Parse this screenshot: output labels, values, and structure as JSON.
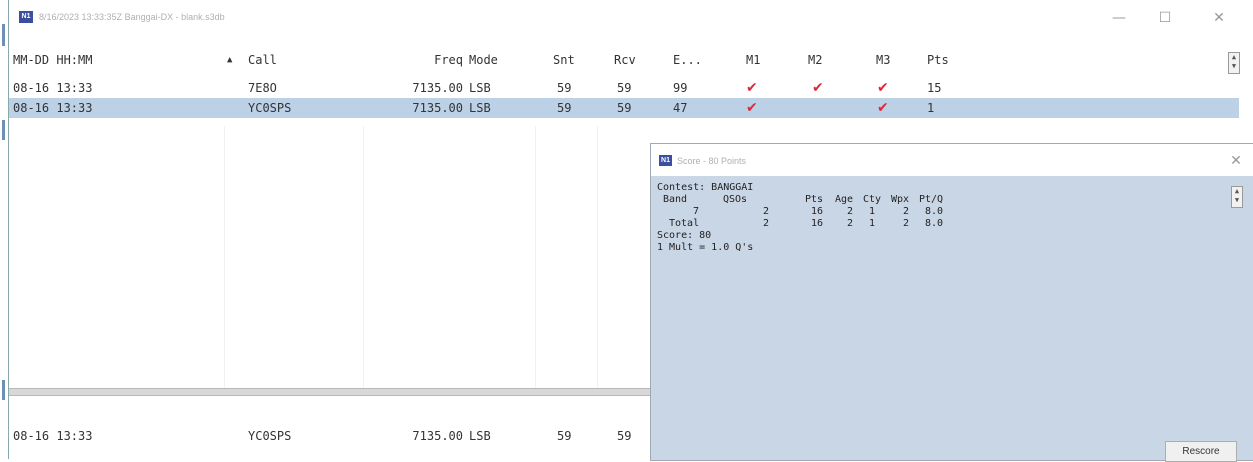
{
  "window": {
    "title": "8/16/2023 13:33:35Z Banggai-DX - blank.s3db",
    "minimize_glyph": "—",
    "maximize_glyph": "☐",
    "close_glyph": "✕",
    "icon": "n1mm-logo-icon"
  },
  "log": {
    "columns": {
      "datetime": "MM-DD HH:MM",
      "sort_indicator": "▲",
      "call": "Call",
      "freq": "Freq",
      "mode": "Mode",
      "snt": "Snt",
      "rcv": "Rcv",
      "exch": "E...",
      "m1": "M1",
      "m2": "M2",
      "m3": "M3",
      "pts": "Pts"
    },
    "rows": [
      {
        "datetime": "08-16 13:33",
        "call": "7E8O",
        "freq": "7135.00",
        "mode": "LSB",
        "snt": "59",
        "rcv": "59",
        "exch": "99",
        "m1": "✔",
        "m2": "✔",
        "m3": "✔",
        "pts": "15"
      },
      {
        "datetime": "08-16 13:33",
        "call": "YC0SPS",
        "freq": "7135.00",
        "mode": "LSB",
        "snt": "59",
        "rcv": "59",
        "exch": "47",
        "m1": "✔",
        "m2": "",
        "m3": "✔",
        "pts": "1"
      }
    ],
    "entry": {
      "datetime": "08-16 13:33",
      "call": "YC0SPS",
      "freq": "7135.00",
      "mode": "LSB",
      "snt": "59",
      "rcv": "59"
    }
  },
  "score_window": {
    "title": "Score - 80 Points",
    "close_glyph": "✕",
    "contest_line": "Contest: BANGGAI",
    "headers": {
      "band": "Band",
      "qsos": "QSOs",
      "pts": "Pts",
      "age": "Age",
      "cty": "Cty",
      "wpx": "Wpx",
      "ptq": "Pt/Q"
    },
    "rows": [
      {
        "band": "7",
        "qsos": "2",
        "pts": "16",
        "age": "2",
        "cty": "1",
        "wpx": "2",
        "ptq": "8.0"
      },
      {
        "band": "Total",
        "qsos": "2",
        "pts": "16",
        "age": "2",
        "cty": "1",
        "wpx": "2",
        "ptq": "8.0"
      }
    ],
    "score_line": "Score: 80",
    "mult_line": "1 Mult = 1.0 Q's",
    "rescore_label": "Rescore"
  },
  "spinner_glyphs": {
    "up": "▲",
    "down": "▼"
  }
}
